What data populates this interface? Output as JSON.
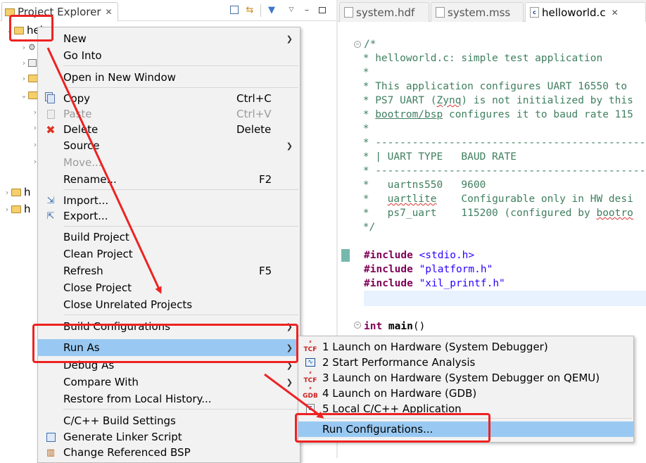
{
  "explorer": {
    "tab_title": "Project Explorer",
    "tree": [
      {
        "label": "hel",
        "kind": "project"
      },
      {
        "label": "",
        "kind": "child"
      },
      {
        "label": "",
        "kind": "child"
      },
      {
        "label": "",
        "kind": "child"
      },
      {
        "label": "",
        "kind": "child"
      },
      {
        "label": "h",
        "kind": "project"
      },
      {
        "label": "h",
        "kind": "project"
      }
    ]
  },
  "editor": {
    "tabs": [
      {
        "label": "system.hdf"
      },
      {
        "label": "system.mss"
      },
      {
        "label": "helloworld.c"
      }
    ],
    "lines": {
      "l1": "/*",
      "l2": " * helloworld.c: simple test application",
      "l3": " *",
      "l4": " * This application configures UART 16550 to",
      "l5a": " * PS7 UART (",
      "l5b": "Zynq",
      "l5c": ") is not initialized by this",
      "l6a": " * ",
      "l6b": "bootrom/bsp",
      "l6c": " configures it to baud rate 115",
      "l7": " *",
      "l8": " * ----------------------------------------------",
      "l9": " * | UART TYPE   BAUD RATE",
      "l10": " * ----------------------------------------------",
      "l11": " *   uartns550   9600",
      "l12a": " *   ",
      "l12b": "uartlite",
      "l12c": "    Configurable only in HW desi",
      "l13a": " *   ps7_uart    115200 (configured by ",
      "l13b": "bootro",
      "l14": " */",
      "inc_kw": "#include",
      "inc1": " <stdio.h>",
      "inc2": " \"platform.h\"",
      "inc3": " \"xil_printf.h\"",
      "int_kw": "int",
      "main": " main",
      "main_rest": "()"
    }
  },
  "context_menu": {
    "new": "New",
    "go_into": "Go Into",
    "open_new_window": "Open in New Window",
    "copy": "Copy",
    "copy_acc": "Ctrl+C",
    "paste": "Paste",
    "paste_acc": "Ctrl+V",
    "delete": "Delete",
    "delete_acc": "Delete",
    "source": "Source",
    "move": "Move...",
    "rename": "Rename...",
    "rename_acc": "F2",
    "import": "Import...",
    "export": "Export...",
    "build_project": "Build Project",
    "clean_project": "Clean Project",
    "refresh": "Refresh",
    "refresh_acc": "F5",
    "close_project": "Close Project",
    "close_unrelated": "Close Unrelated Projects",
    "build_configurations": "Build Configurations",
    "run_as": "Run As",
    "debug_as": "Debug As",
    "compare_with": "Compare With",
    "restore_history": "Restore from Local History...",
    "cpp_build_settings": "C/C++ Build Settings",
    "generate_linker": "Generate Linker Script",
    "change_bsp": "Change Referenced BSP"
  },
  "run_as_submenu": {
    "item1": "1 Launch on Hardware (System Debugger)",
    "item2": "2 Start Performance Analysis",
    "item3": "3 Launch on Hardware (System Debugger on QEMU)",
    "item4": "4 Launch on Hardware (GDB)",
    "item5": "5 Local C/C++ Application",
    "run_configurations": "Run Configurations..."
  },
  "colors": {
    "highlight": "#ee2222",
    "selection": "#99c9f2",
    "comment": "#3f7f5f",
    "keyword": "#7f0055",
    "string": "#2a00ff"
  }
}
